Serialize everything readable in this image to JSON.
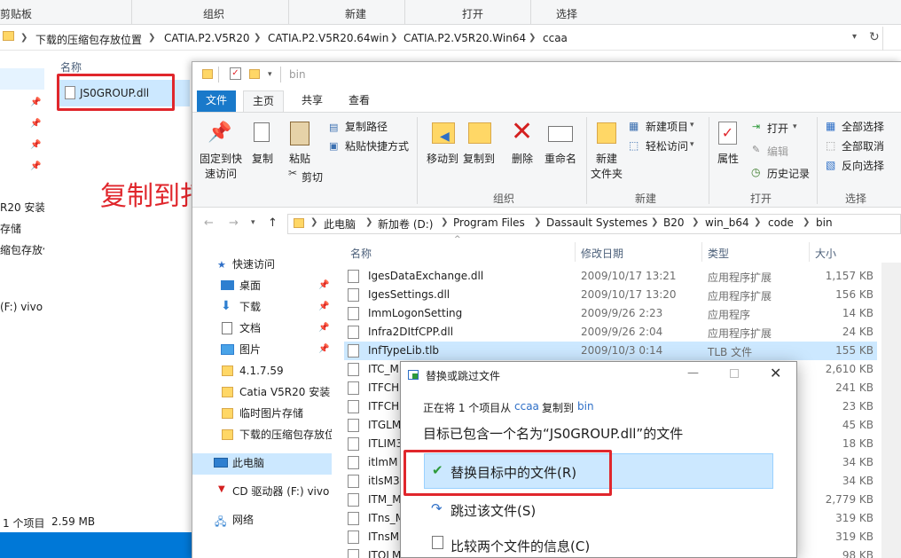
{
  "background_window": {
    "ribbon_groups": [
      "剪贴板",
      "组织",
      "新建",
      "打开",
      "选择"
    ],
    "breadcrumb": [
      "下载的压缩包存放位置",
      "CATIA.P2.V5R20",
      "CATIA.P2.V5R20.64win",
      "CATIA.P2.V5R20.Win64",
      "ccaa"
    ],
    "column_name": "名称",
    "file_name": "JS0GROUP.dll",
    "nav_items": [
      "R20 安装",
      "存储",
      "缩包存放位",
      "(F:) vivo"
    ],
    "status_count": "1 个项目",
    "status_size": "2.59 MB"
  },
  "front_window": {
    "title": "bin",
    "tabs": [
      "文件",
      "主页",
      "共享",
      "查看"
    ],
    "ribbon": {
      "pin_label_1": "固定到快",
      "pin_label_2": "速访问",
      "copy": "复制",
      "paste": "粘贴",
      "copy_path": "复制路径",
      "paste_shortcut": "粘贴快捷方式",
      "cut": "剪切",
      "move_to": "移动到",
      "copy_to": "复制到",
      "delete": "删除",
      "rename": "重命名",
      "new_folder_1": "新建",
      "new_folder_2": "文件夹",
      "new_item": "新建项目",
      "easy_access": "轻松访问",
      "properties": "属性",
      "open": "打开",
      "edit": "编辑",
      "history": "历史记录",
      "select_all": "全部选择",
      "select_none": "全部取消",
      "invert_selection": "反向选择",
      "group_organize": "组织",
      "group_new": "新建",
      "group_open": "打开",
      "group_select": "选择"
    },
    "breadcrumb": [
      "此电脑",
      "新加卷 (D:)",
      "Program Files",
      "Dassault Systemes",
      "B20",
      "win_b64",
      "code",
      "bin"
    ],
    "nav": {
      "quick_access": "快速访问",
      "items": [
        "桌面",
        "下载",
        "文档",
        "图片",
        "4.1.7.59",
        "Catia V5R20 安装",
        "临时图片存储",
        "下载的压缩包存放位"
      ],
      "this_pc": "此电脑",
      "cd_drive": "CD 驱动器 (F:) vivo",
      "network": "网络"
    },
    "columns": [
      "名称",
      "修改日期",
      "类型",
      "大小"
    ],
    "files": [
      {
        "name": "IgesDataExchange.dll",
        "date": "2009/10/17 13:21",
        "type": "应用程序扩展",
        "size": "1,157 KB"
      },
      {
        "name": "IgesSettings.dll",
        "date": "2009/10/17 13:20",
        "type": "应用程序扩展",
        "size": "156 KB"
      },
      {
        "name": "ImmLogonSetting",
        "date": "2009/9/26 2:23",
        "type": "应用程序",
        "size": "14 KB"
      },
      {
        "name": "Infra2DItfCPP.dll",
        "date": "2009/9/26 2:04",
        "type": "应用程序扩展",
        "size": "24 KB"
      },
      {
        "name": "InfTypeLib.tlb",
        "date": "2009/10/3 0:14",
        "type": "TLB 文件",
        "size": "155 KB"
      },
      {
        "name": "ITC_M",
        "size": "2,610 KB"
      },
      {
        "name": "ITFCH",
        "size": "241 KB"
      },
      {
        "name": "ITFCH",
        "size": "23 KB"
      },
      {
        "name": "ITGLM",
        "size": "45 KB"
      },
      {
        "name": "ITLIM3",
        "size": "18 KB"
      },
      {
        "name": "itlmM",
        "size": "34 KB"
      },
      {
        "name": "itlsM3",
        "size": "34 KB"
      },
      {
        "name": "ITM_M",
        "size": "2,779 KB"
      },
      {
        "name": "ITns_M",
        "size": "319 KB"
      },
      {
        "name": "ITnsM",
        "size": "319 KB"
      },
      {
        "name": "ITOLM",
        "size": "98 KB"
      }
    ]
  },
  "dialog": {
    "title": "替换或跳过文件",
    "info_prefix": "正在将 1 个项目从",
    "source": "ccaa",
    "info_mid": "复制到",
    "dest": "bin",
    "headline": "目标已包含一个名为“JS0GROUP.dll”的文件",
    "opt_replace": "替换目标中的文件(R)",
    "opt_skip": "跳过该文件(S)",
    "opt_compare": "比较两个文件的信息(C)"
  },
  "annotation": "复制到打开的文件夹粘贴并替换",
  "colors": {
    "accent": "#1979ca",
    "selection": "#cce8ff",
    "highlight": "#e0262c",
    "folder": "#ffd766"
  }
}
